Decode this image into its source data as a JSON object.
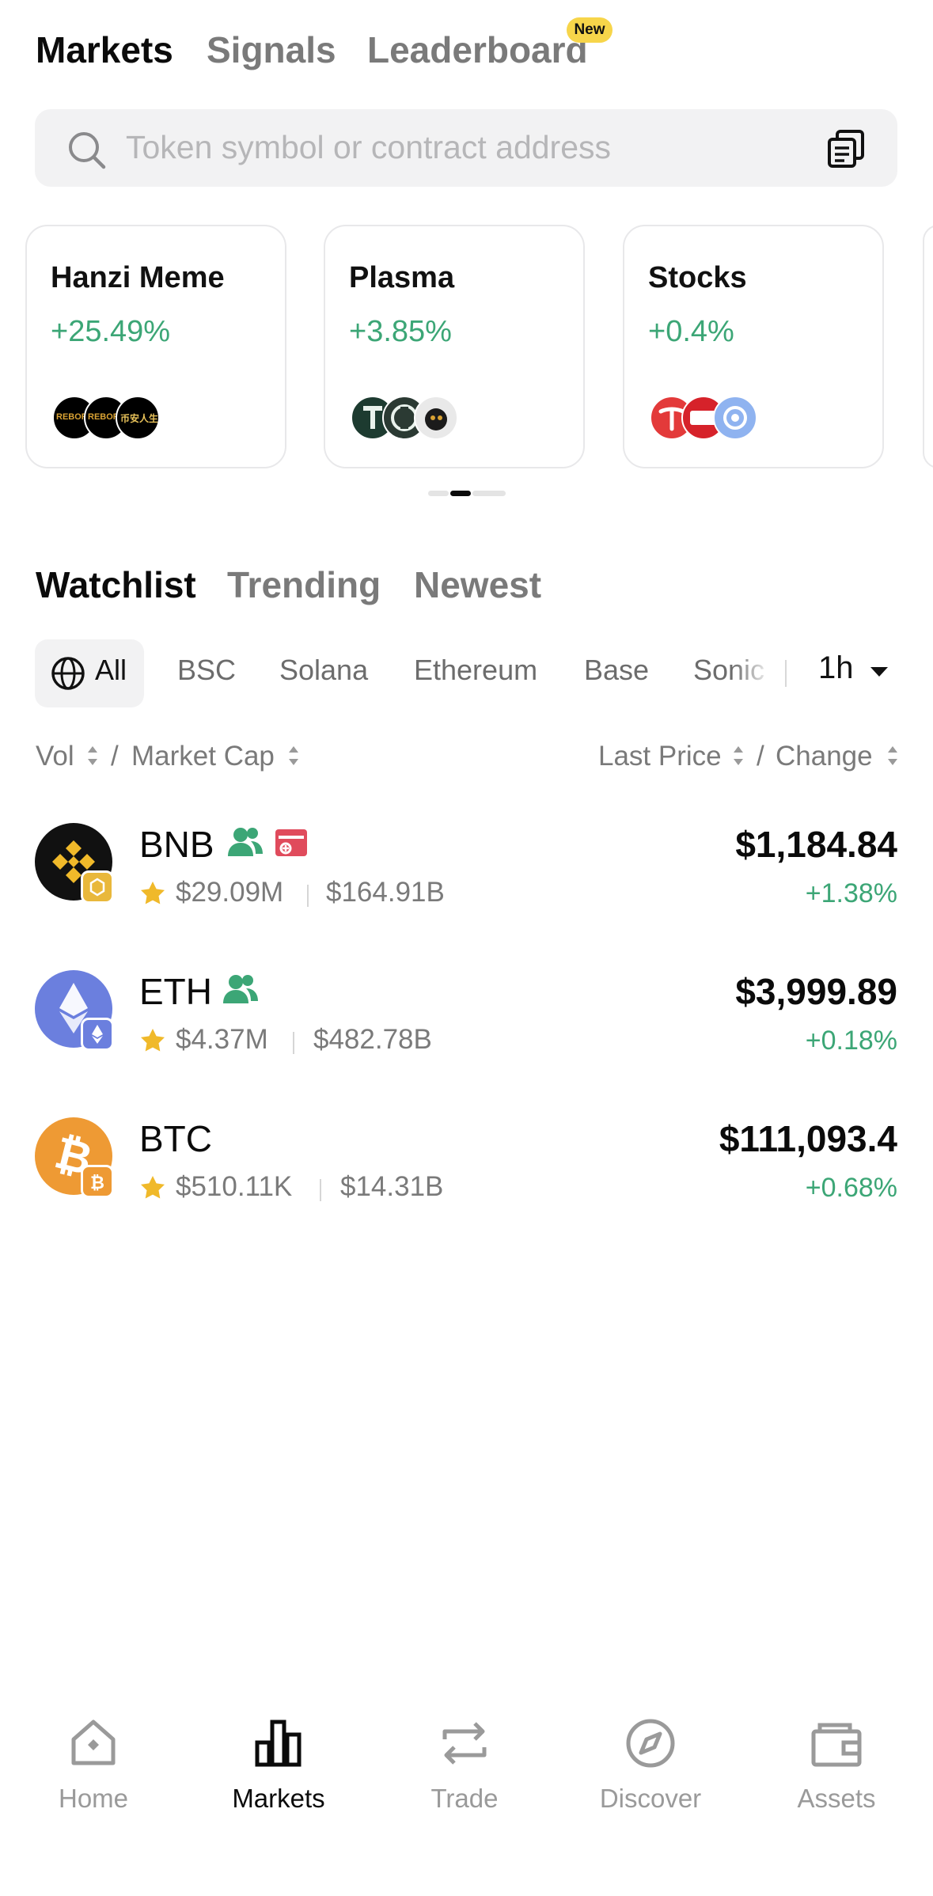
{
  "top_tabs": [
    {
      "label": "Markets",
      "active": true
    },
    {
      "label": "Signals",
      "active": false
    },
    {
      "label": "Leaderboard",
      "active": false,
      "badge": "New"
    }
  ],
  "search": {
    "placeholder": "Token symbol or contract address"
  },
  "categories": [
    {
      "title": "Hanzi Meme",
      "change": "+25.49%",
      "coin_labels": [
        "REBOR",
        "REBOR",
        "币安人生"
      ]
    },
    {
      "title": "Plasma",
      "change": "+3.85%"
    },
    {
      "title": "Stocks",
      "change": "+0.4%"
    }
  ],
  "section_tabs": [
    {
      "label": "Watchlist",
      "active": true
    },
    {
      "label": "Trending",
      "active": false
    },
    {
      "label": "Newest",
      "active": false
    }
  ],
  "chains": [
    "All",
    "BSC",
    "Solana",
    "Ethereum",
    "Base",
    "Sonic"
  ],
  "timeframe": "1h",
  "columns": {
    "vol": "Vol",
    "sep": "/",
    "mcap": "Market Cap",
    "price": "Last Price",
    "change": "Change"
  },
  "tokens": [
    {
      "symbol": "BNB",
      "vol": "$29.09M",
      "mcap": "$164.91B",
      "price": "$1,184.84",
      "change": "+1.38%",
      "logo_color": "#111111",
      "chain_color": "#e9b83b"
    },
    {
      "symbol": "ETH",
      "vol": "$4.37M",
      "mcap": "$482.78B",
      "price": "$3,999.89",
      "change": "+0.18%",
      "logo_color": "#6b7fde",
      "chain_color": "#6b7fde"
    },
    {
      "symbol": "BTC",
      "vol": "$510.11K",
      "mcap": "$14.31B",
      "price": "$111,093.4",
      "change": "+0.68%",
      "logo_color": "#ee9a34",
      "chain_color": "#ee9a34"
    }
  ],
  "bottom_nav": [
    {
      "label": "Home",
      "icon": "home-icon",
      "active": false
    },
    {
      "label": "Markets",
      "icon": "markets-icon",
      "active": true
    },
    {
      "label": "Trade",
      "icon": "trade-icon",
      "active": false
    },
    {
      "label": "Discover",
      "icon": "discover-icon",
      "active": false
    },
    {
      "label": "Assets",
      "icon": "assets-icon",
      "active": false
    }
  ],
  "colors": {
    "positive": "#3ca676",
    "badge": "#f7d54a",
    "star": "#f0b92a"
  }
}
